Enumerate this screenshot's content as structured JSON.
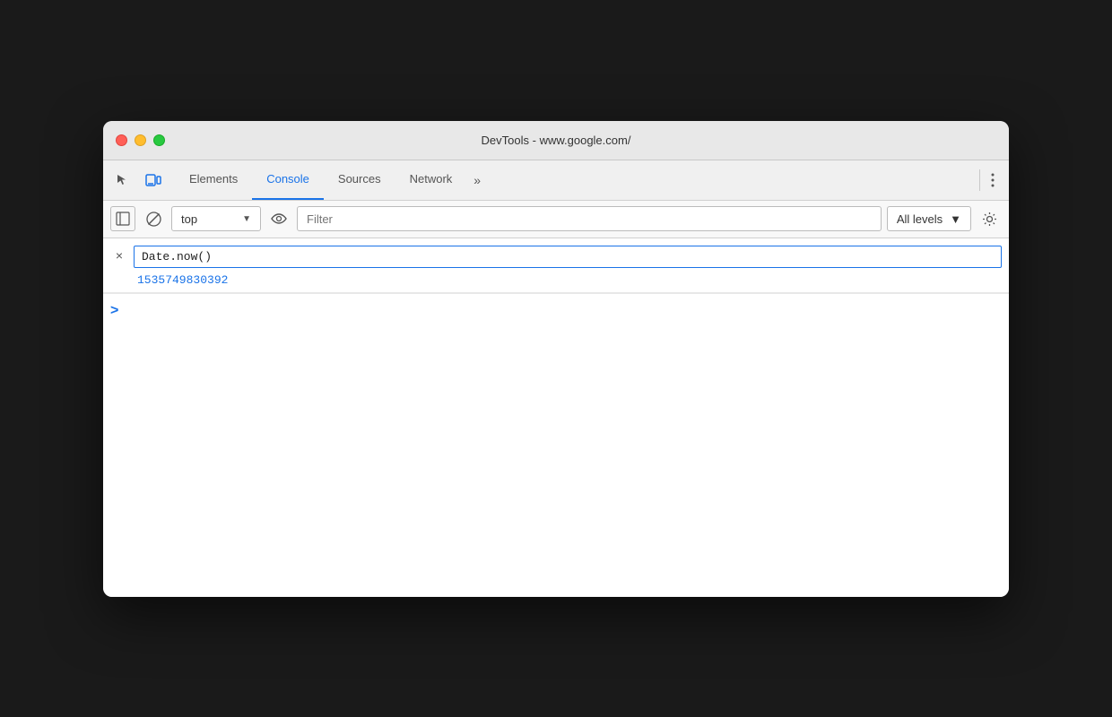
{
  "window": {
    "title": "DevTools - www.google.com/"
  },
  "traffic_lights": {
    "red": "close",
    "yellow": "minimize",
    "green": "maximize"
  },
  "tabs": [
    {
      "id": "elements",
      "label": "Elements",
      "active": false
    },
    {
      "id": "console",
      "label": "Console",
      "active": true
    },
    {
      "id": "sources",
      "label": "Sources",
      "active": false
    },
    {
      "id": "network",
      "label": "Network",
      "active": false
    }
  ],
  "tab_more_label": "»",
  "toolbar": {
    "context_value": "top",
    "context_placeholder": "top",
    "filter_placeholder": "Filter",
    "levels_label": "All levels",
    "eye_title": "Live expressions",
    "clear_title": "Clear console",
    "sidebar_title": "Show console sidebar",
    "gear_title": "Console settings"
  },
  "console": {
    "entry_input": "Date.now()",
    "entry_result": "1535749830392",
    "close_symbol": "×",
    "prompt_symbol": ">"
  }
}
